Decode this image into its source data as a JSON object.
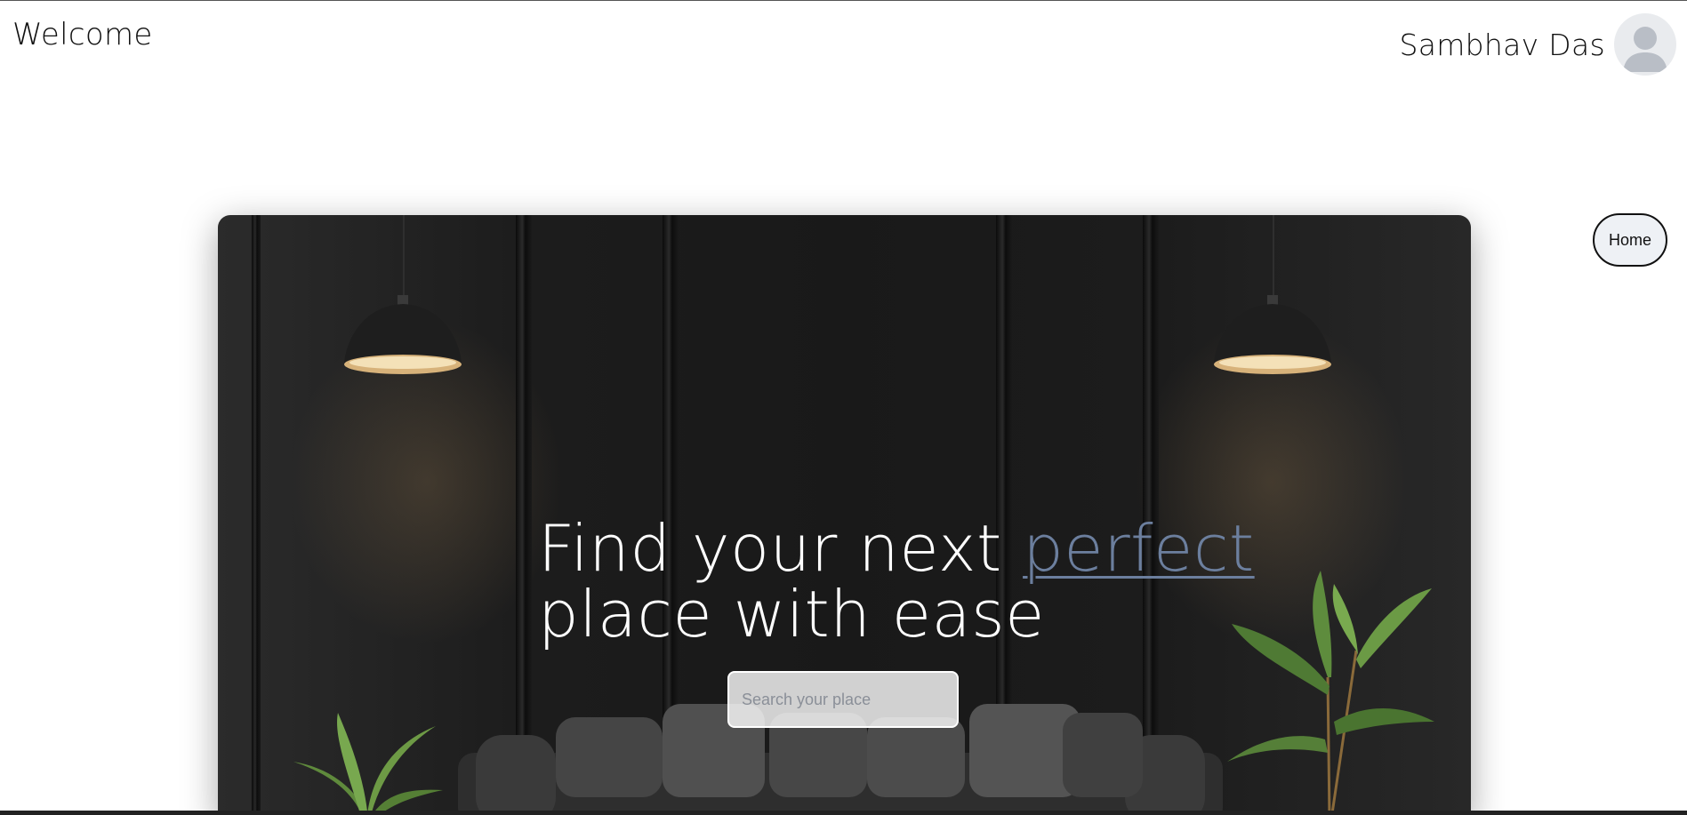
{
  "header": {
    "title": "Welcome",
    "user_name": "Sambhav Das",
    "avatar_icon": "user-avatar-icon"
  },
  "nav": {
    "home_label": "Home"
  },
  "hero": {
    "headline_part1": "Find your next ",
    "headline_accent": "perfect",
    "headline_part2": "place with ease",
    "search_placeholder": "Search your place",
    "accent_color": "#6c7f9e"
  }
}
